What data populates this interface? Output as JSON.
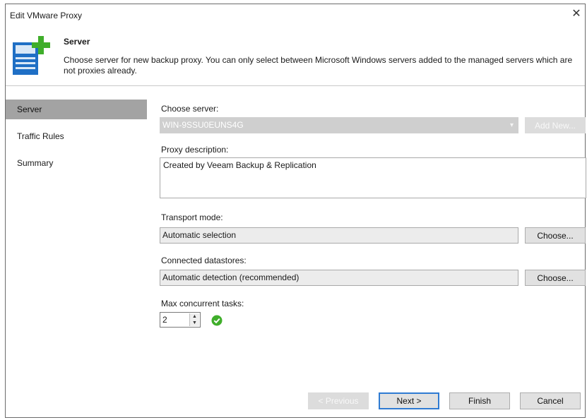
{
  "window": {
    "title": "Edit VMware Proxy",
    "close_glyph": "✕"
  },
  "header": {
    "icon": "server-add-icon",
    "title": "Server",
    "description": "Choose server for new backup proxy. You can only select between Microsoft Windows servers added to the managed servers which are not proxies already."
  },
  "sidebar": {
    "items": [
      {
        "label": "Server",
        "active": true
      },
      {
        "label": "Traffic Rules",
        "active": false
      },
      {
        "label": "Summary",
        "active": false
      }
    ]
  },
  "form": {
    "choose_server_label": "Choose server:",
    "server_value": "WIN-9SSU0EUNS4G",
    "add_new_label": "Add New...",
    "proxy_description_label": "Proxy description:",
    "proxy_description_value": "Created by Veeam Backup & Replication",
    "transport_mode_label": "Transport mode:",
    "transport_mode_value": "Automatic selection",
    "choose_label": "Choose...",
    "datastores_label": "Connected datastores:",
    "datastores_value": "Automatic detection (recommended)",
    "max_tasks_label": "Max concurrent tasks:",
    "max_tasks_value": "2"
  },
  "footer": {
    "previous_label": "< Previous",
    "next_label": "Next >",
    "finish_label": "Finish",
    "cancel_label": "Cancel"
  },
  "colors": {
    "accent_green": "#3fae2a",
    "icon_blue": "#1f6fc5",
    "active_sidebar": "#a3a3a3"
  }
}
